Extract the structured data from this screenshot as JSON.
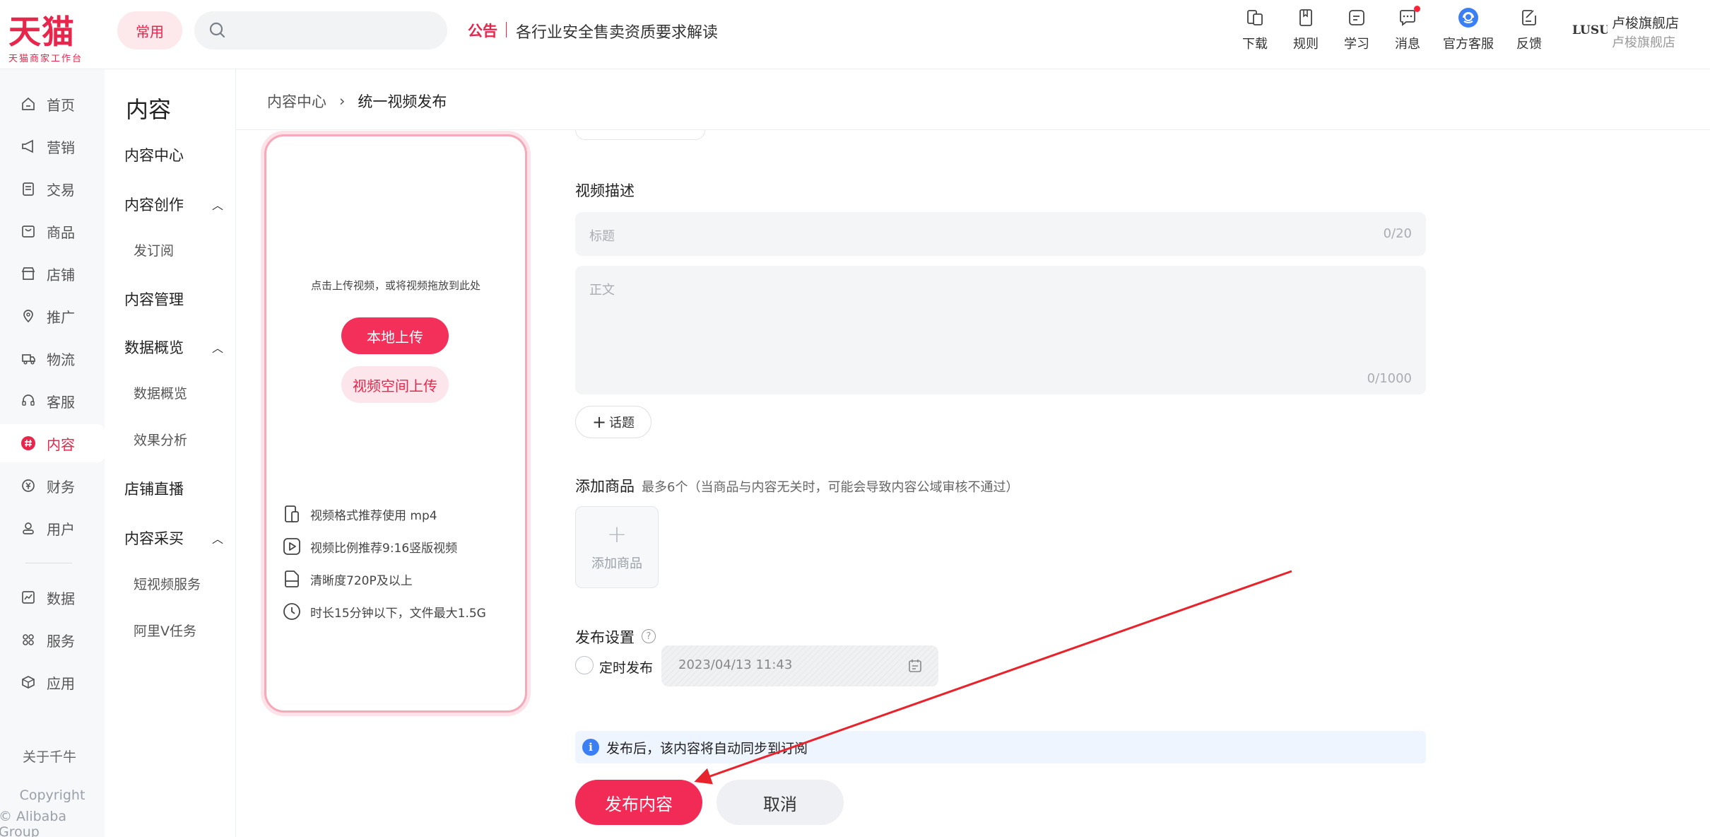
{
  "brand": {
    "logo": "天猫",
    "subtitle": "天猫商家工作台"
  },
  "topbar": {
    "common_label": "常用",
    "search": {
      "placeholder": ""
    },
    "notice_tag": "公告",
    "notice_text": "各行业安全售卖资质要求解读",
    "tools": [
      {
        "label": "下载",
        "icon": "download-icon"
      },
      {
        "label": "规则",
        "icon": "rules-icon"
      },
      {
        "label": "学习",
        "icon": "learn-icon"
      },
      {
        "label": "消息",
        "icon": "message-icon",
        "badge": true
      },
      {
        "label": "官方客服",
        "icon": "official-service-icon"
      },
      {
        "label": "反馈",
        "icon": "feedback-icon"
      }
    ],
    "shop": {
      "logo_text": "LUSUO",
      "name": "卢梭旗舰店",
      "sub": "卢梭旗舰店"
    }
  },
  "leftnav": {
    "items": [
      {
        "label": "首页",
        "icon": "home-icon"
      },
      {
        "label": "营销",
        "icon": "megaphone-icon"
      },
      {
        "label": "交易",
        "icon": "order-icon"
      },
      {
        "label": "商品",
        "icon": "product-icon"
      },
      {
        "label": "店铺",
        "icon": "store-icon"
      },
      {
        "label": "推广",
        "icon": "promote-icon"
      },
      {
        "label": "物流",
        "icon": "logistics-icon"
      },
      {
        "label": "客服",
        "icon": "headset-icon"
      },
      {
        "label": "内容",
        "icon": "hashtag-icon",
        "active": true
      },
      {
        "label": "财务",
        "icon": "finance-icon"
      },
      {
        "label": "用户",
        "icon": "user-icon"
      },
      {
        "label": "数据",
        "icon": "data-icon"
      },
      {
        "label": "服务",
        "icon": "service-icon"
      },
      {
        "label": "应用",
        "icon": "app-icon"
      }
    ],
    "about": "关于千牛",
    "copyright_1": "Copyright",
    "copyright_2": "© Alibaba Group"
  },
  "submenu": {
    "title": "内容",
    "content_center": "内容中心",
    "creation": "内容创作",
    "subscribe": "发订阅",
    "management": "内容管理",
    "data_overview": "数据概览",
    "data_overview_leaf": "数据概览",
    "effect": "效果分析",
    "live": "店铺直播",
    "purchase": "内容采买",
    "short_video": "短视频服务",
    "aliv": "阿里V任务"
  },
  "breadcrumb": {
    "parent": "内容中心",
    "current": "统一视频发布"
  },
  "upload": {
    "hint": "点击上传视频，或将视频拖放到此处",
    "local_button": "本地上传",
    "space_button": "视频空间上传",
    "tips": [
      "视频格式推荐使用 mp4",
      "视频比例推荐9:16竖版视频",
      "清晰度720P及以上",
      "时长15分钟以下，文件最大1.5G"
    ]
  },
  "form": {
    "description_label": "视频描述",
    "title_placeholder": "标题",
    "title_count": "0/20",
    "body_placeholder": "正文",
    "body_count": "0/1000",
    "topic_button": "话题",
    "add_product_label": "添加商品",
    "add_product_hint": "最多6个（当商品与内容无关时，可能会导致内容公域审核不通过）",
    "add_product_button": "添加商品",
    "publish_settings_label": "发布设置",
    "scheduled_label": "定时发布",
    "scheduled_time": "2023/04/13 11:43",
    "info_text": "发布后，该内容将自动同步到订阅",
    "publish_button": "发布内容",
    "cancel_button": "取消"
  },
  "colors": {
    "brand": "#e8254b",
    "annotation_arrow": "#e8232b"
  }
}
